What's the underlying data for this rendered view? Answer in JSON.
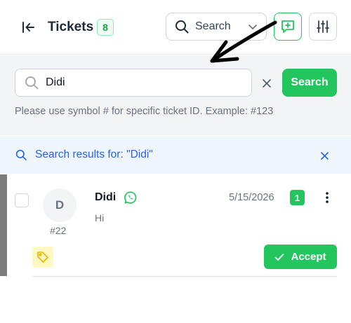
{
  "header": {
    "title": "Tickets",
    "count": "8",
    "search_mode_label": "Search"
  },
  "search": {
    "value": "Didi",
    "placeholder": "",
    "button_label": "Search",
    "hint": "Please use symbol # for specific ticket ID. Example: #123"
  },
  "results": {
    "text": "Search results for: \"Didi\""
  },
  "ticket": {
    "avatar_letter": "D",
    "id": "#22",
    "name": "Didi",
    "message": "Hi",
    "date": "5/15/2026",
    "unread_count": "1",
    "accept_label": "Accept",
    "channel_icon": "whatsapp-icon",
    "accent_color": "#7c7c7c"
  },
  "colors": {
    "brand_green": "#22c55e",
    "link_blue": "#2563eb",
    "results_bg": "#eff6ff"
  }
}
